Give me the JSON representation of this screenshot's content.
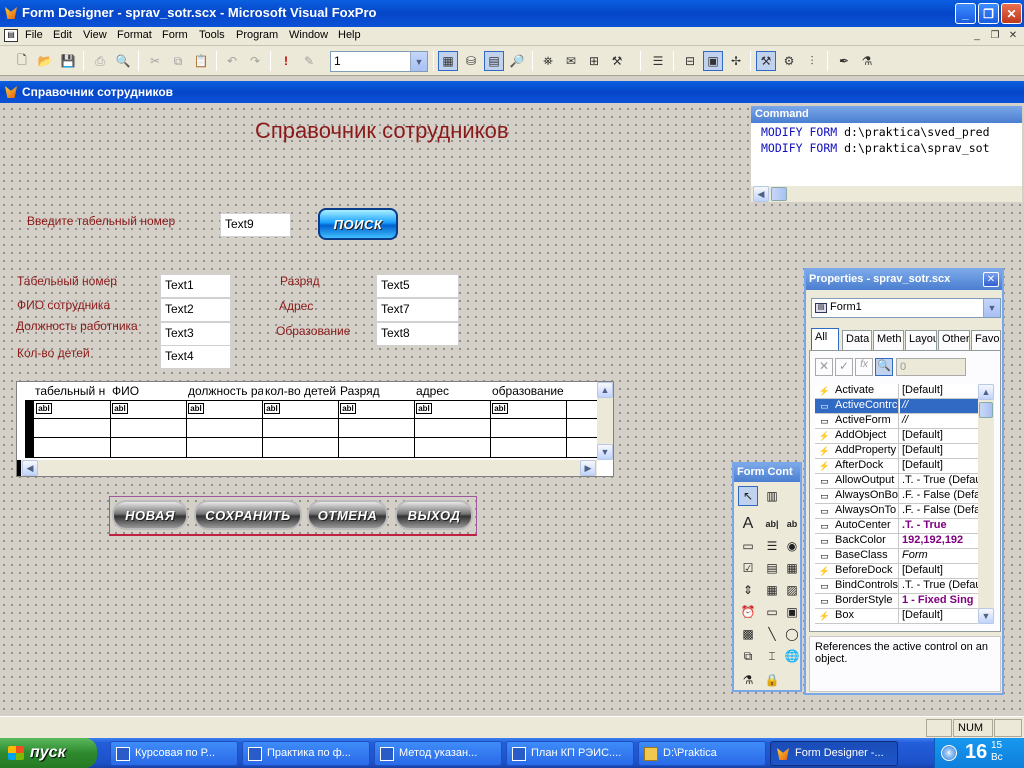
{
  "window": {
    "title": "Form Designer - sprav_sotr.scx - Microsoft Visual FoxPro"
  },
  "menu": [
    "File",
    "Edit",
    "View",
    "Format",
    "Form",
    "Tools",
    "Program",
    "Window",
    "Help"
  ],
  "toolbar": {
    "combo_value": "1"
  },
  "form": {
    "title": "Справочник сотрудников",
    "heading": "Справочник сотрудников",
    "prompt_label": "Введите табельный номер",
    "prompt_box": "Text9",
    "search_button": "ПОИСК",
    "fields_left": [
      {
        "label": "Табельный номер",
        "box": "Text1"
      },
      {
        "label": "ФИО сотрудника",
        "box": "Text2"
      },
      {
        "label": "Должность работника",
        "box": "Text3"
      },
      {
        "label": "Кол-во детей",
        "box": "Text4"
      }
    ],
    "fields_right": [
      {
        "label": "Разряд",
        "box": "Text5"
      },
      {
        "label": "Адрес",
        "box": "Text7"
      },
      {
        "label": "Образование",
        "box": "Text8"
      }
    ],
    "grid_headers": [
      "табельный н",
      "ФИО",
      "должность ра",
      "кол-во детей",
      "Разряд",
      "адрес",
      "образование"
    ],
    "grid_cell_tag": "abl",
    "buttons": [
      "НОВАЯ",
      "СОХРАНИТЬ",
      "ОТМЕНА",
      "ВЫХОД"
    ]
  },
  "command": {
    "title": "Command",
    "lines": [
      {
        "kw1": "MODIFY",
        "kw2": "FORM",
        "path": "d:\\praktica\\sved_pred"
      },
      {
        "kw1": "MODIFY",
        "kw2": "FORM",
        "path": "d:\\praktica\\sprav_sot"
      }
    ]
  },
  "properties": {
    "title": "Properties - sprav_sotr.scx",
    "object": "Form1",
    "tabs": [
      "All",
      "Data",
      "Meth",
      "Layou",
      "Other",
      "Favor"
    ],
    "value_box": "0",
    "rows": [
      {
        "name": "Activate",
        "value": "[Default]"
      },
      {
        "name": "ActiveContrc",
        "value": "//"
      },
      {
        "name": "ActiveForm",
        "value": "//"
      },
      {
        "name": "AddObject",
        "value": "[Default]"
      },
      {
        "name": "AddProperty",
        "value": "[Default]"
      },
      {
        "name": "AfterDock",
        "value": "[Default]"
      },
      {
        "name": "AllowOutput",
        "value": ".T. - True (Defau"
      },
      {
        "name": "AlwaysOnBo",
        "value": ".F. - False (Defa"
      },
      {
        "name": "AlwaysOnTo",
        "value": ".F. - False (Defa"
      },
      {
        "name": "AutoCenter",
        "value": ".T. - True"
      },
      {
        "name": "BackColor",
        "value": "192,192,192"
      },
      {
        "name": "BaseClass",
        "value": "Form"
      },
      {
        "name": "BeforeDock",
        "value": "[Default]"
      },
      {
        "name": "BindControls",
        "value": ".T. - True (Defau"
      },
      {
        "name": "BorderStyle",
        "value": "1 - Fixed Sing"
      },
      {
        "name": "Box",
        "value": "[Default]"
      }
    ],
    "description": "References the active control on an object."
  },
  "form_controls": {
    "title": "Form Cont"
  },
  "statusbar": {
    "num": "NUM"
  },
  "taskbar": {
    "start": "пуск",
    "tasks": [
      "Курсовая по Р...",
      "Практика по ф...",
      "Метод указан...",
      "План КП РЭИС....",
      "D:\\Praktica",
      "Form Designer -..."
    ],
    "clock_hour": "16",
    "clock_min": "15",
    "clock_day": "Вс"
  },
  "colors": {
    "label": "#8b1a1a",
    "titlebar": "#0a52d8",
    "selection": "#316ac5"
  }
}
